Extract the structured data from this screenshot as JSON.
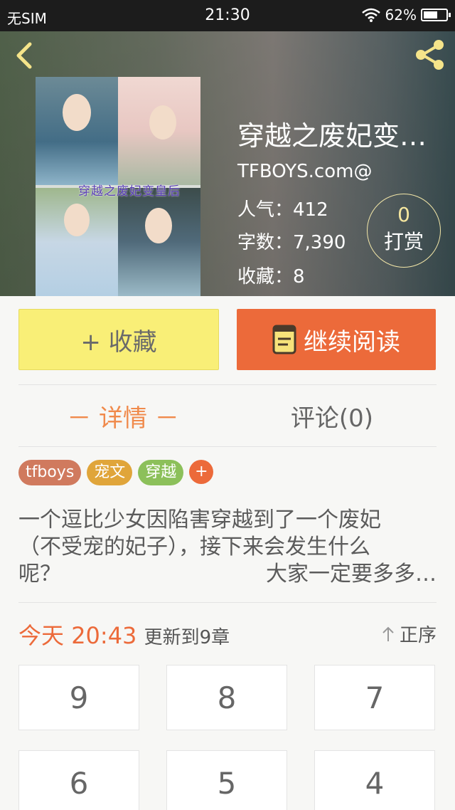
{
  "status_bar": {
    "carrier": "无SIM",
    "time": "21:30",
    "battery": "62%",
    "battery_level": 0.62
  },
  "book": {
    "cover_title": "穿越之废妃变皇后",
    "title": "穿越之废妃变…",
    "author": "TFBOYS.com@",
    "stats": {
      "popularity": "人气：412",
      "words": "字数：7,390",
      "favorites": "收藏：8"
    },
    "reward": {
      "count": "0",
      "label": "打赏"
    }
  },
  "actions": {
    "favorite": "+ 收藏",
    "continue": "继续阅读"
  },
  "tabs": {
    "detail": "－ 详情 －",
    "comments": "评论(0)"
  },
  "tags": [
    {
      "label": "tfboys",
      "color": "#d07a5e"
    },
    {
      "label": "宠文",
      "color": "#e0a53a"
    },
    {
      "label": "穿越",
      "color": "#8cc05a"
    }
  ],
  "tag_add": "+",
  "description": {
    "line1": "一个逗比少女因陷害穿越到了一个废妃",
    "line2": "（不受宠的妃子），接下来会发生什么",
    "line3_left": "呢？",
    "line3_right": "大家一定要多多…"
  },
  "update": {
    "day": "今天",
    "time": "20:43",
    "text": "更新到9章",
    "sort": "正序"
  },
  "chapters": [
    "9",
    "8",
    "7",
    "6",
    "5",
    "4"
  ]
}
